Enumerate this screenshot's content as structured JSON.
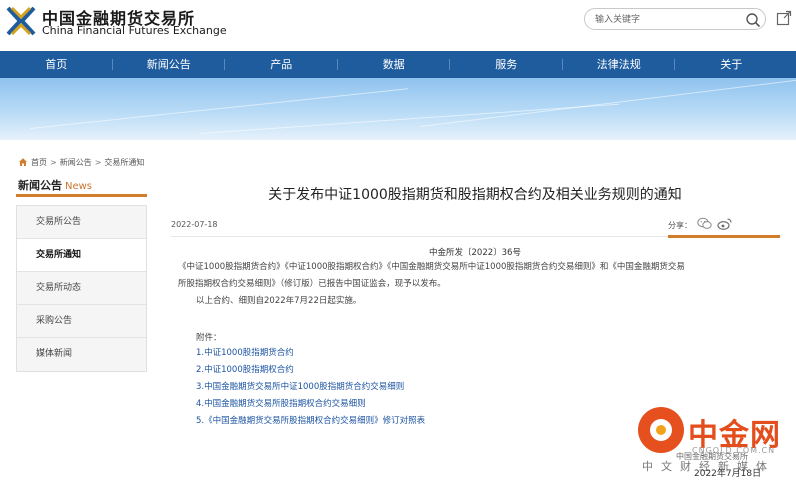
{
  "header": {
    "logo_cn": "中国金融期货交易所",
    "logo_en": "China Financial Futures Exchange",
    "search_placeholder": "输入关键字"
  },
  "nav": {
    "items": [
      "首页",
      "新闻公告",
      "产品",
      "数据",
      "服务",
      "法律法规",
      "关于"
    ]
  },
  "breadcrumb": {
    "items": [
      "首页",
      "新闻公告",
      "交易所通知"
    ]
  },
  "sidebar": {
    "title": "新闻公告",
    "title_en": "News",
    "items": [
      {
        "label": "交易所公告",
        "active": false
      },
      {
        "label": "交易所通知",
        "active": true
      },
      {
        "label": "交易所动态",
        "active": false
      },
      {
        "label": "采购公告",
        "active": false
      },
      {
        "label": "媒体新闻",
        "active": false
      }
    ]
  },
  "article": {
    "title": "关于发布中证1000股指期货和股指期权合约及相关业务规则的通知",
    "date": "2022-07-18",
    "share_label": "分享：",
    "doc_no": "中金所发〔2022〕36号",
    "para1_line1": "《中证1000股指期货合约》《中证1000股指期权合约》《中国金融期货交易所中证1000股指期货合约交易细则》和《中国金融期货交易",
    "para1_line2": "所股指期权合约交易细则》（修订版）已报告中国证监会，现予以发布。",
    "para2": "以上合约、细则自2022年7月22日起实施。",
    "attachments_label": "附件：",
    "attachments": [
      "1.中证1000股指期货合约",
      "2.中证1000股指期权合约",
      "3.中国金融期货交易所中证1000股指期货合约交易细则",
      "4.中国金融期货交易所股指期权合约交易细则",
      "5.《中国金融期货交易所股指期权合约交易细则》修订对照表"
    ],
    "sign_org": "中国金融期货交易所",
    "sign_date": "2022年7月18日"
  },
  "watermark": {
    "brand": "中金网",
    "domain": "CNGOLD.COM.CN",
    "tagline": "中文财经新媒体"
  },
  "colors": {
    "nav_bg": "#1f5c9e",
    "accent": "#d17d2c",
    "link": "#1e55a3",
    "watermark": "#e44e1c"
  }
}
